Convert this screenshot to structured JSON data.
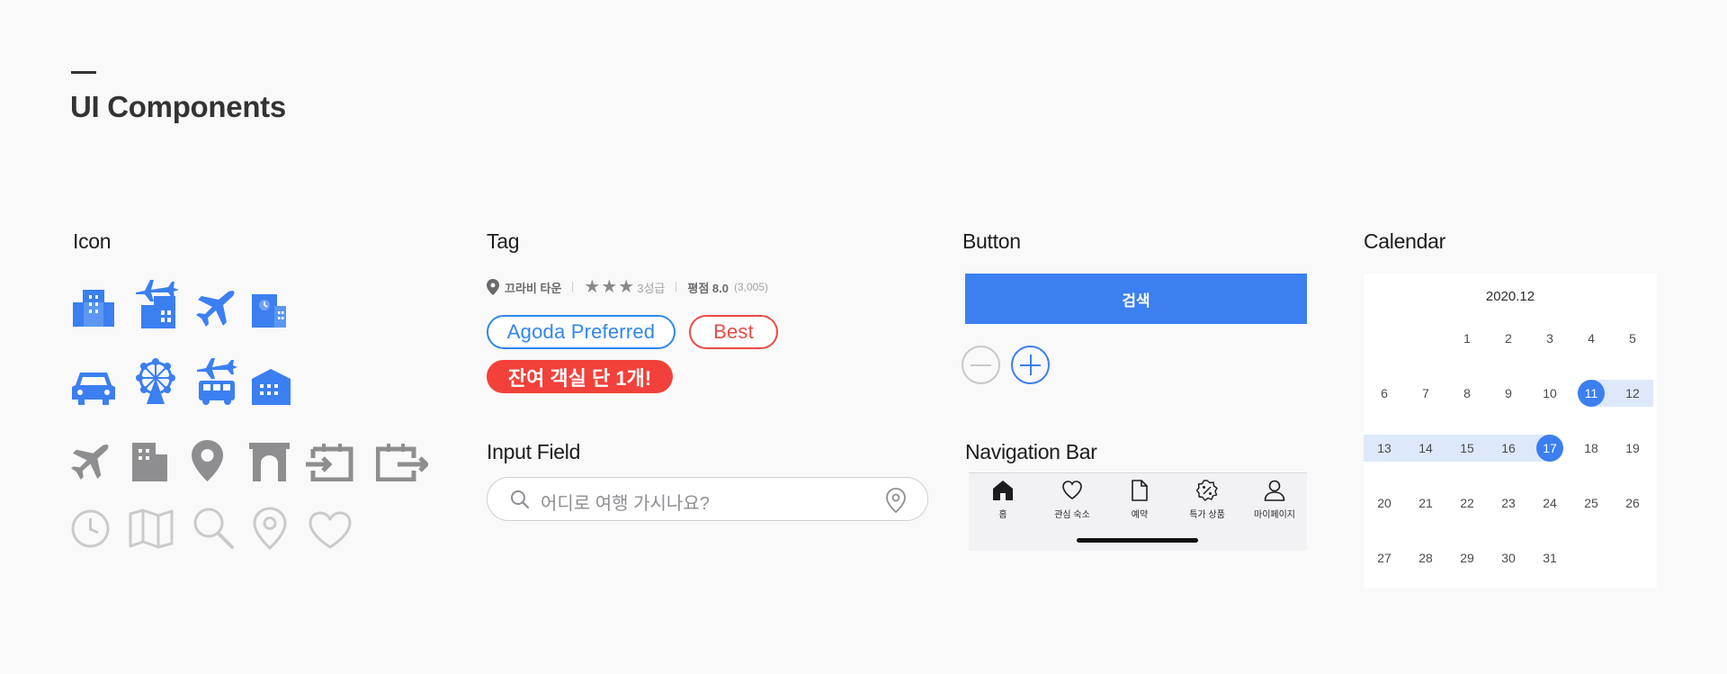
{
  "page": {
    "title": "UI Components"
  },
  "sections": {
    "icon": "Icon",
    "tag": "Tag",
    "button": "Button",
    "calendar": "Calendar",
    "input_field": "Input Field",
    "navigation_bar": "Navigation Bar"
  },
  "icons": {
    "row1": [
      "building-icon",
      "flight-hotel-icon",
      "airplane-icon",
      "hotel-door-icon"
    ],
    "row2": [
      "car-icon",
      "ferris-wheel-icon",
      "flight-bus-icon",
      "house-icon"
    ],
    "row3": [
      "airplane-gray-icon",
      "building-gray-icon",
      "location-pin-gray-icon",
      "gate-gray-icon",
      "check-in-icon",
      "check-out-icon"
    ],
    "row4": [
      "clock-outline-icon",
      "map-outline-icon",
      "search-outline-icon",
      "location-outline-icon",
      "heart-outline-icon"
    ]
  },
  "tag": {
    "location": "끄라비 타운",
    "stars_filled": 3,
    "grade": "3성급",
    "rating_label": "평점 8.0",
    "reviews": "(3,005)",
    "agoda_preferred": "Agoda Preferred",
    "best": "Best",
    "remaining": "잔여 객실 단 1개!"
  },
  "input": {
    "placeholder": "어디로 여행 가시나요?"
  },
  "button": {
    "search_label": "검색"
  },
  "navbar": {
    "items": [
      {
        "label": "홈",
        "icon": "home-icon"
      },
      {
        "label": "관심 숙소",
        "icon": "heart-icon"
      },
      {
        "label": "예약",
        "icon": "document-icon"
      },
      {
        "label": "특가 상품",
        "icon": "discount-badge-icon"
      },
      {
        "label": "마이페이지",
        "icon": "person-icon"
      }
    ]
  },
  "calendar": {
    "month": "2020.12",
    "weeks": [
      [
        "",
        "",
        "1",
        "2",
        "3",
        "4",
        "5"
      ],
      [
        "6",
        "7",
        "8",
        "9",
        "10",
        "11",
        "12"
      ],
      [
        "13",
        "14",
        "15",
        "16",
        "17",
        "18",
        "19"
      ],
      [
        "20",
        "21",
        "22",
        "23",
        "24",
        "25",
        "26"
      ],
      [
        "27",
        "28",
        "29",
        "30",
        "31",
        "",
        ""
      ]
    ],
    "selected_start": "11",
    "selected_end": "17"
  },
  "colors": {
    "accent": "#3b7ff0",
    "agoda": "#2f86f0",
    "best": "#ea4b43",
    "remaining_bg": "#f2413a",
    "icon_gray": "#8e8e90",
    "range_bg": "#dde9fb"
  }
}
